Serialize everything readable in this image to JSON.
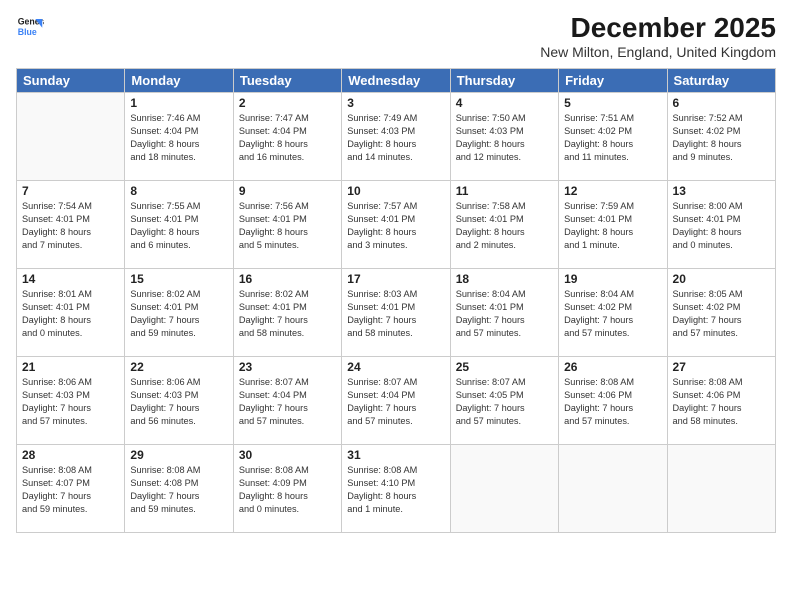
{
  "header": {
    "logo_line1": "General",
    "logo_line2": "Blue",
    "title": "December 2025",
    "subtitle": "New Milton, England, United Kingdom"
  },
  "columns": [
    "Sunday",
    "Monday",
    "Tuesday",
    "Wednesday",
    "Thursday",
    "Friday",
    "Saturday"
  ],
  "weeks": [
    [
      {
        "date": "",
        "info": ""
      },
      {
        "date": "1",
        "info": "Sunrise: 7:46 AM\nSunset: 4:04 PM\nDaylight: 8 hours\nand 18 minutes."
      },
      {
        "date": "2",
        "info": "Sunrise: 7:47 AM\nSunset: 4:04 PM\nDaylight: 8 hours\nand 16 minutes."
      },
      {
        "date": "3",
        "info": "Sunrise: 7:49 AM\nSunset: 4:03 PM\nDaylight: 8 hours\nand 14 minutes."
      },
      {
        "date": "4",
        "info": "Sunrise: 7:50 AM\nSunset: 4:03 PM\nDaylight: 8 hours\nand 12 minutes."
      },
      {
        "date": "5",
        "info": "Sunrise: 7:51 AM\nSunset: 4:02 PM\nDaylight: 8 hours\nand 11 minutes."
      },
      {
        "date": "6",
        "info": "Sunrise: 7:52 AM\nSunset: 4:02 PM\nDaylight: 8 hours\nand 9 minutes."
      }
    ],
    [
      {
        "date": "7",
        "info": "Sunrise: 7:54 AM\nSunset: 4:01 PM\nDaylight: 8 hours\nand 7 minutes."
      },
      {
        "date": "8",
        "info": "Sunrise: 7:55 AM\nSunset: 4:01 PM\nDaylight: 8 hours\nand 6 minutes."
      },
      {
        "date": "9",
        "info": "Sunrise: 7:56 AM\nSunset: 4:01 PM\nDaylight: 8 hours\nand 5 minutes."
      },
      {
        "date": "10",
        "info": "Sunrise: 7:57 AM\nSunset: 4:01 PM\nDaylight: 8 hours\nand 3 minutes."
      },
      {
        "date": "11",
        "info": "Sunrise: 7:58 AM\nSunset: 4:01 PM\nDaylight: 8 hours\nand 2 minutes."
      },
      {
        "date": "12",
        "info": "Sunrise: 7:59 AM\nSunset: 4:01 PM\nDaylight: 8 hours\nand 1 minute."
      },
      {
        "date": "13",
        "info": "Sunrise: 8:00 AM\nSunset: 4:01 PM\nDaylight: 8 hours\nand 0 minutes."
      }
    ],
    [
      {
        "date": "14",
        "info": "Sunrise: 8:01 AM\nSunset: 4:01 PM\nDaylight: 8 hours\nand 0 minutes."
      },
      {
        "date": "15",
        "info": "Sunrise: 8:02 AM\nSunset: 4:01 PM\nDaylight: 7 hours\nand 59 minutes."
      },
      {
        "date": "16",
        "info": "Sunrise: 8:02 AM\nSunset: 4:01 PM\nDaylight: 7 hours\nand 58 minutes."
      },
      {
        "date": "17",
        "info": "Sunrise: 8:03 AM\nSunset: 4:01 PM\nDaylight: 7 hours\nand 58 minutes."
      },
      {
        "date": "18",
        "info": "Sunrise: 8:04 AM\nSunset: 4:01 PM\nDaylight: 7 hours\nand 57 minutes."
      },
      {
        "date": "19",
        "info": "Sunrise: 8:04 AM\nSunset: 4:02 PM\nDaylight: 7 hours\nand 57 minutes."
      },
      {
        "date": "20",
        "info": "Sunrise: 8:05 AM\nSunset: 4:02 PM\nDaylight: 7 hours\nand 57 minutes."
      }
    ],
    [
      {
        "date": "21",
        "info": "Sunrise: 8:06 AM\nSunset: 4:03 PM\nDaylight: 7 hours\nand 57 minutes."
      },
      {
        "date": "22",
        "info": "Sunrise: 8:06 AM\nSunset: 4:03 PM\nDaylight: 7 hours\nand 56 minutes."
      },
      {
        "date": "23",
        "info": "Sunrise: 8:07 AM\nSunset: 4:04 PM\nDaylight: 7 hours\nand 57 minutes."
      },
      {
        "date": "24",
        "info": "Sunrise: 8:07 AM\nSunset: 4:04 PM\nDaylight: 7 hours\nand 57 minutes."
      },
      {
        "date": "25",
        "info": "Sunrise: 8:07 AM\nSunset: 4:05 PM\nDaylight: 7 hours\nand 57 minutes."
      },
      {
        "date": "26",
        "info": "Sunrise: 8:08 AM\nSunset: 4:06 PM\nDaylight: 7 hours\nand 57 minutes."
      },
      {
        "date": "27",
        "info": "Sunrise: 8:08 AM\nSunset: 4:06 PM\nDaylight: 7 hours\nand 58 minutes."
      }
    ],
    [
      {
        "date": "28",
        "info": "Sunrise: 8:08 AM\nSunset: 4:07 PM\nDaylight: 7 hours\nand 59 minutes."
      },
      {
        "date": "29",
        "info": "Sunrise: 8:08 AM\nSunset: 4:08 PM\nDaylight: 7 hours\nand 59 minutes."
      },
      {
        "date": "30",
        "info": "Sunrise: 8:08 AM\nSunset: 4:09 PM\nDaylight: 8 hours\nand 0 minutes."
      },
      {
        "date": "31",
        "info": "Sunrise: 8:08 AM\nSunset: 4:10 PM\nDaylight: 8 hours\nand 1 minute."
      },
      {
        "date": "",
        "info": ""
      },
      {
        "date": "",
        "info": ""
      },
      {
        "date": "",
        "info": ""
      }
    ]
  ]
}
